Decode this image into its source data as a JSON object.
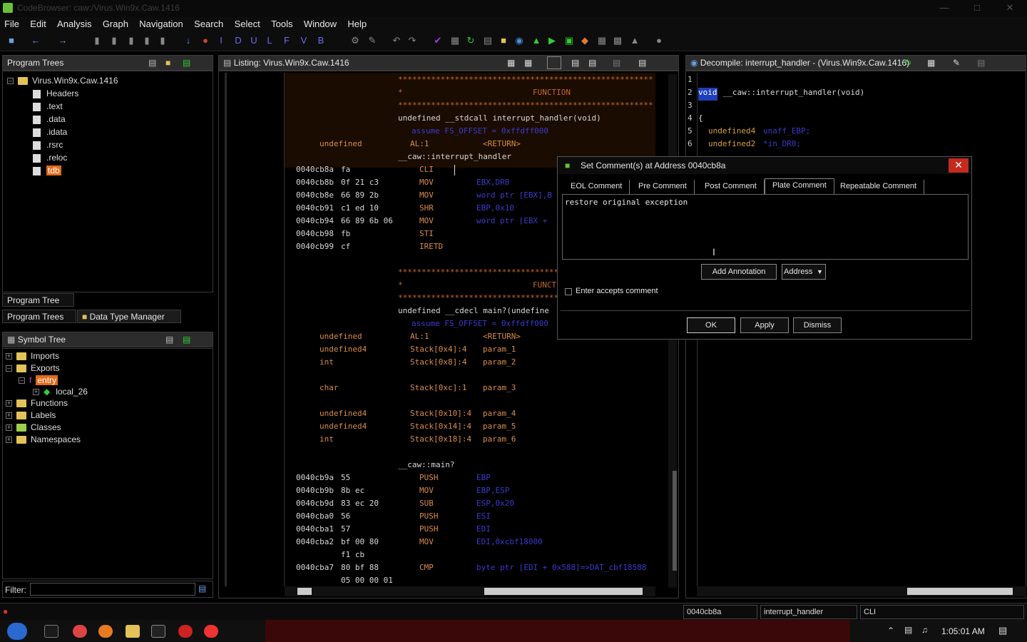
{
  "window": {
    "title": "CodeBrowser: caw:/Virus.Win9x.Caw.1416"
  },
  "menu": [
    "File",
    "Edit",
    "Analysis",
    "Graph",
    "Navigation",
    "Search",
    "Select",
    "Tools",
    "Window",
    "Help"
  ],
  "toolbar_letters": [
    "I",
    "D",
    "U",
    "L",
    "F",
    "V",
    "B"
  ],
  "program_trees": {
    "title": "Program Trees",
    "root": "Virus.Win9x.Caw.1416",
    "items": [
      "Headers",
      ".text",
      ".data",
      ".idata",
      ".rsrc",
      ".reloc",
      "tdb"
    ],
    "tab": "Program Tree"
  },
  "bottom_tabs": {
    "program_trees": "Program Trees",
    "data_type_manager": "Data Type Manager"
  },
  "symbol_tree": {
    "title": "Symbol Tree",
    "items": [
      "Imports",
      "Exports",
      "entry",
      "local_26",
      "Functions",
      "Labels",
      "Classes",
      "Namespaces"
    ],
    "filter_label": "Filter:"
  },
  "listing": {
    "title": "Listing:",
    "program": "Virus.Win9x.Caw.1416",
    "function_header": {
      "stars": "******************************************************",
      "label": "FUNCTION",
      "signature": "undefined __stdcall interrupt_handler(void)",
      "assume": "assume FS_OFFSET = 0xffdff000",
      "ret_type": "undefined",
      "ret_loc": "AL:1",
      "ret_tag": "<RETURN>",
      "name": "__caw::interrupt_handler"
    },
    "instructions1": [
      {
        "addr": "0040cb8a",
        "bytes": "fa",
        "mn": "CLI",
        "op": ""
      },
      {
        "addr": "0040cb8b",
        "bytes": "0f 21 c3",
        "mn": "MOV",
        "op": "EBX,DR0"
      },
      {
        "addr": "0040cb8e",
        "bytes": "66 89 2b",
        "mn": "MOV",
        "op": "word ptr [EBX],B"
      },
      {
        "addr": "0040cb91",
        "bytes": "c1 ed 10",
        "mn": "SHR",
        "op": "EBP,0x10"
      },
      {
        "addr": "0040cb94",
        "bytes": "66 89 6b 06",
        "mn": "MOV",
        "op": "word ptr [EBX +"
      },
      {
        "addr": "0040cb98",
        "bytes": "fb",
        "mn": "STI",
        "op": ""
      },
      {
        "addr": "0040cb99",
        "bytes": "cf",
        "mn": "IRETD",
        "op": ""
      }
    ],
    "function2": {
      "label": "FUNCT",
      "signature": "undefined __cdecl main?(undefine",
      "assume": "assume FS_OFFSET = 0xffdff000",
      "params": [
        {
          "type": "undefined",
          "loc": "AL:1",
          "name": "<RETURN>"
        },
        {
          "type": "undefined4",
          "loc": "Stack[0x4]:4",
          "name": "param_1"
        },
        {
          "type": "int",
          "loc": "Stack[0x8]:4",
          "name": "param_2"
        },
        {
          "type": "char",
          "loc": "Stack[0xc]:1",
          "name": "param_3"
        },
        {
          "type": "undefined4",
          "loc": "Stack[0x10]:4",
          "name": "param_4"
        },
        {
          "type": "undefined4",
          "loc": "Stack[0x14]:4",
          "name": "param_5"
        },
        {
          "type": "int",
          "loc": "Stack[0x18]:4",
          "name": "param_6"
        }
      ],
      "name": "__caw::main?"
    },
    "instructions2": [
      {
        "addr": "0040cb9a",
        "bytes": "55",
        "mn": "PUSH",
        "op": "EBP"
      },
      {
        "addr": "0040cb9b",
        "bytes": "8b ec",
        "mn": "MOV",
        "op": "EBP,ESP"
      },
      {
        "addr": "0040cb9d",
        "bytes": "83 ec 20",
        "mn": "SUB",
        "op": "ESP,0x20"
      },
      {
        "addr": "0040cba0",
        "bytes": "56",
        "mn": "PUSH",
        "op": "ESI"
      },
      {
        "addr": "0040cba1",
        "bytes": "57",
        "mn": "PUSH",
        "op": "EDI"
      },
      {
        "addr": "0040cba2",
        "bytes": "bf 00 80",
        "mn": "MOV",
        "op": "EDI,0xcbf18000"
      },
      {
        "addr": "",
        "bytes": "f1 cb",
        "mn": "",
        "op": ""
      },
      {
        "addr": "0040cba7",
        "bytes": "80 bf 88",
        "mn": "CMP",
        "op": "byte ptr [EDI + 0x588]=>DAT_cbf18588"
      },
      {
        "addr": "",
        "bytes": "05 00 00 01",
        "mn": "",
        "op": ""
      }
    ]
  },
  "decompile": {
    "title": "Decompile: interrupt_handler - (Virus.Win9x.Caw.1416)",
    "lines": [
      {
        "n": "1",
        "t": ""
      },
      {
        "n": "2",
        "kw": "void",
        "t": " __caw::interrupt_handler(void)"
      },
      {
        "n": "3",
        "t": ""
      },
      {
        "n": "4",
        "t": "{"
      },
      {
        "n": "5",
        "kw": "undefined4",
        "v": "unaff_EBP;"
      },
      {
        "n": "6",
        "kw": "undefined2",
        "v": "*in_DR0;"
      }
    ]
  },
  "dialog": {
    "title": "Set Comment(s) at Address 0040cb8a",
    "tabs": [
      "EOL Comment",
      "Pre Comment",
      "Post Comment",
      "Plate Comment",
      "Repeatable Comment"
    ],
    "active_tab": "Plate Comment",
    "comment_text": "restore original exception",
    "add_annotation": "Add Annotation",
    "annotation_type": "Address",
    "enter_accepts": "Enter accepts comment",
    "ok": "OK",
    "apply": "Apply",
    "dismiss": "Dismiss"
  },
  "status": {
    "address": "0040cb8a",
    "function": "interrupt_handler",
    "instruction": "CLI"
  },
  "taskbar": {
    "time": "1:05:01 AM"
  }
}
